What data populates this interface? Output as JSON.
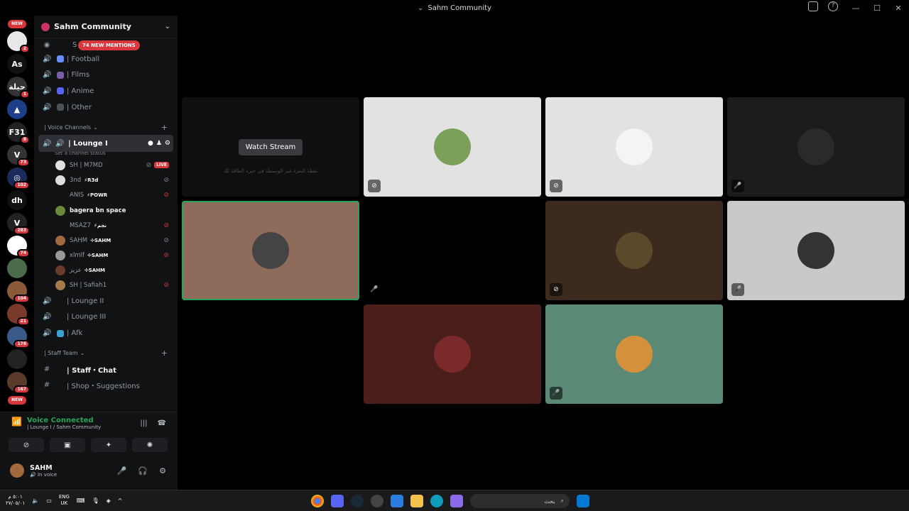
{
  "window": {
    "title": "Sahm Community",
    "controls": [
      "minimize-icon",
      "maximize-icon",
      "close-icon"
    ]
  },
  "servers": {
    "items": [
      {
        "type": "new",
        "label": "NEW"
      },
      {
        "label": "",
        "badge": "2",
        "color": "#e8e8e8"
      },
      {
        "label": "As",
        "color": "#111"
      },
      {
        "label": "حيلة",
        "badge": "1",
        "color": "#333"
      },
      {
        "label": "▲",
        "color": "#1d3f8a"
      },
      {
        "label": "F31",
        "badge": "8",
        "color": "#222"
      },
      {
        "label": "V",
        "badge": "73",
        "color": "#333"
      },
      {
        "label": "◎",
        "badge": "102",
        "color": "#1a2a5a"
      },
      {
        "label": "dh",
        "color": "#111"
      },
      {
        "label": "V",
        "badge": "283",
        "color": "#222"
      },
      {
        "label": "",
        "badge": "74",
        "color": "#fff"
      },
      {
        "label": "",
        "color": "#4a6a4a"
      },
      {
        "label": "",
        "badge": "104",
        "color": "#8a5a3a"
      },
      {
        "label": "",
        "badge": "21",
        "color": "#7a3a2a"
      },
      {
        "label": "",
        "badge": "176",
        "color": "#3a5a8a"
      },
      {
        "label": "",
        "color": "#222"
      },
      {
        "label": "",
        "badge": "167",
        "color": "#5a3a2a"
      },
      {
        "type": "new",
        "label": "NEW"
      }
    ]
  },
  "sidebar": {
    "guild_name": "Sahm Community",
    "mentions_pill": "74 NEW MENTIONS",
    "partial_top": "S",
    "channels_top": [
      {
        "label": "| Football",
        "emoji_color": "#6b8cff"
      },
      {
        "label": "| Films",
        "emoji_color": "#7b5ea7"
      },
      {
        "label": "| Anime",
        "emoji_color": "#5865f2"
      },
      {
        "label": "| Other",
        "emoji_color": "#4e5058"
      }
    ],
    "voice_category": "| Voice Channels",
    "active_channel": "| Lounge I",
    "channel_status": "Set a channel status",
    "voice_users": [
      {
        "name": "SH | M7MD",
        "tag": "",
        "av": "#e0e0e0",
        "live": "LIVE",
        "mic": "grey"
      },
      {
        "name": "3nd",
        "tag": "⚡R3d",
        "av": "#ddd",
        "mic": "grey"
      },
      {
        "name": "ANIS",
        "tag": "⚡POWR",
        "av": "#111",
        "mic": "red"
      },
      {
        "name": "bagera bn space",
        "tag": "",
        "av": "#6a8a3a",
        "bright": true,
        "mic": ""
      },
      {
        "name": "MSAZ7",
        "tag": "⚡نجم",
        "av": "#111",
        "mic": "red"
      },
      {
        "name": "SAHM",
        "tag": "✢SAHM",
        "av": "#a06a3c",
        "mic": "grey"
      },
      {
        "name": "xlmlf",
        "tag": "✢SAHM",
        "av": "#999",
        "mic": "red"
      },
      {
        "name": "عزيز",
        "tag": "✢SAHM",
        "av": "#6a3a2a",
        "mic": ""
      },
      {
        "name": "SH | Safiah1",
        "tag": "",
        "av": "#a87a4a",
        "mic": "red"
      }
    ],
    "channels_bottom": [
      {
        "label": "| Lounge II"
      },
      {
        "label": "| Lounge III"
      },
      {
        "label": "| Afk",
        "emoji_color": "#3aa0d0"
      }
    ],
    "staff_category": "| Staff Team",
    "staff_channels": [
      {
        "label": "| Staff・Chat",
        "bright": true
      },
      {
        "label": "| Shop・Suggestions"
      }
    ]
  },
  "voice_panel": {
    "status": "Voice Connected",
    "location": "| Lounge I / Sahm Community",
    "buttons": [
      "camera-off-icon",
      "screen-share-icon",
      "activities-icon",
      "soundboard-icon"
    ]
  },
  "user_panel": {
    "name": "SAHM",
    "status": "In voice"
  },
  "stage": {
    "watch_label": "Watch Stream",
    "stream_text": "نقطة النقرة غير الوسيطة في حيرة الطاقة لك",
    "tiles": [
      {
        "bg": "#0f0f10",
        "type": "stream",
        "avatar": ""
      },
      {
        "bg": "#e2e2e2",
        "avatar": "#7aa05a",
        "mic": "off"
      },
      {
        "bg": "#e2e2e2",
        "avatar": "#f4f4f4",
        "mic": "off"
      },
      {
        "bg": "#1c1c1c",
        "avatar": "#2a2a2a",
        "mic": "on"
      },
      {
        "bg": "#8f6b5c",
        "avatar": "#444",
        "selected": true
      },
      {
        "bg": "#000000",
        "avatar": "",
        "mic": "on"
      },
      {
        "bg": "#3d2a1e",
        "avatar": "#5a4a2a",
        "mic": "off"
      },
      {
        "bg": "#c9c9c9",
        "avatar": "#333",
        "mic": "on"
      },
      {
        "bg": "#4a1e1a",
        "avatar": "#7a2a2a"
      },
      {
        "bg": "#5a8a76",
        "avatar": "#d4903a",
        "mic": "on"
      }
    ]
  },
  "taskbar": {
    "clock": "٥:٠١ م",
    "date": "٢٧/٠٥/٠١",
    "lang_top": "ENG",
    "lang_bottom": "UK",
    "search_placeholder": "بحث",
    "apps": [
      "chrome",
      "discord",
      "steam",
      "settings",
      "store",
      "files",
      "edge",
      "copilot"
    ]
  }
}
